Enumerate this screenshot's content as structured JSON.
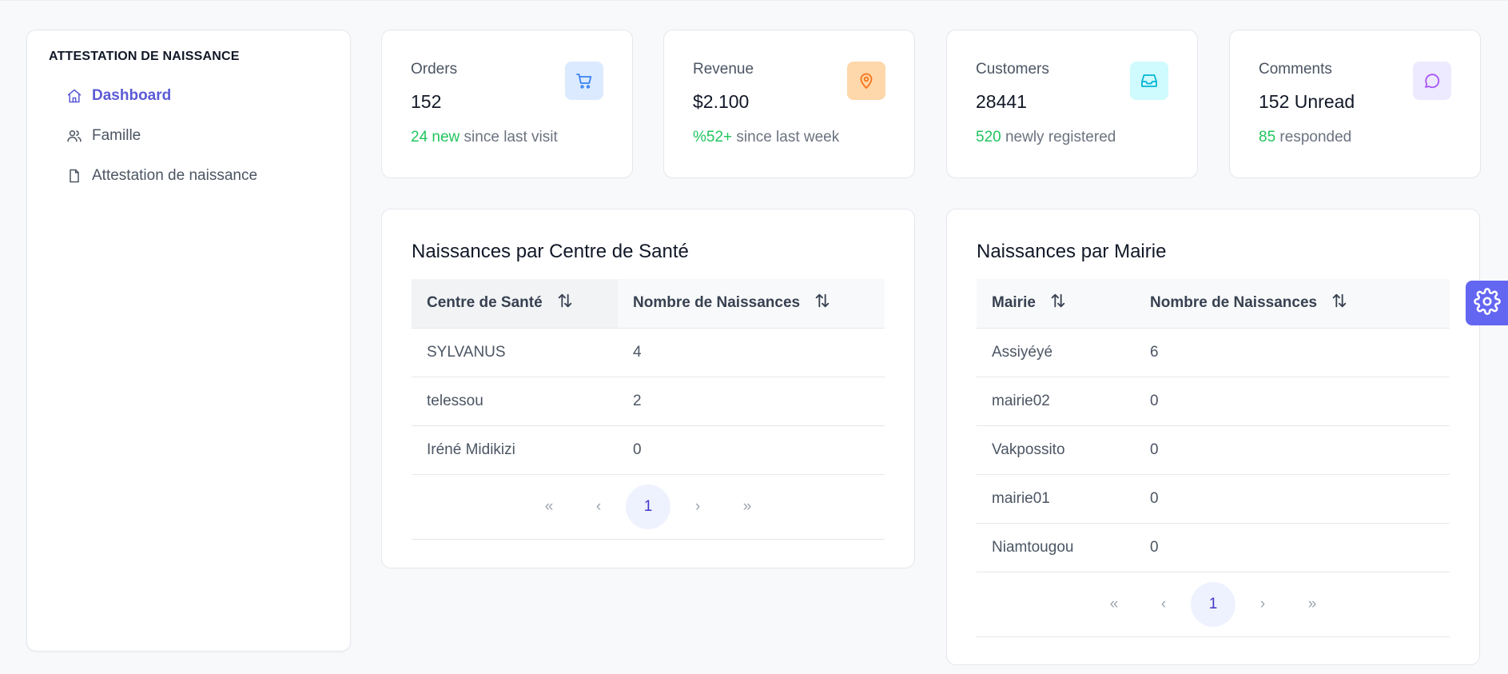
{
  "sidebar": {
    "brand": "ATTESTATION DE NAISSANCE",
    "items": [
      {
        "label": "Dashboard",
        "icon": "home-icon",
        "active": true
      },
      {
        "label": "Famille",
        "icon": "users-icon",
        "active": false
      },
      {
        "label": "Attestation de naissance",
        "icon": "file-icon",
        "active": false
      }
    ]
  },
  "stats": [
    {
      "label": "Orders",
      "value": "152",
      "highlight": "24 new",
      "rest": " since last visit",
      "icon": "cart-icon",
      "badge_bg": "#dbeafe",
      "icon_color": "#3b82f6"
    },
    {
      "label": "Revenue",
      "value": "$2.100",
      "highlight": "%52+",
      "rest": " since last week",
      "icon": "map-pin-icon",
      "badge_bg": "#fed7aa",
      "icon_color": "#f97316"
    },
    {
      "label": "Customers",
      "value": "28441",
      "highlight": "520",
      "rest": " newly registered",
      "icon": "inbox-icon",
      "badge_bg": "#cffafe",
      "icon_color": "#06b6d4"
    },
    {
      "label": "Comments",
      "value": "152 Unread",
      "highlight": "85",
      "rest": " responded",
      "icon": "chat-icon",
      "badge_bg": "#ede9fe",
      "icon_color": "#a855f7"
    }
  ],
  "centre_panel": {
    "title": "Naissances par Centre de Santé",
    "headers": [
      "Centre de Santé",
      "Nombre de Naissances"
    ],
    "rows": [
      [
        "SYLVANUS",
        "4"
      ],
      [
        "telessou",
        "2"
      ],
      [
        "Iréné Midikizi",
        "0"
      ]
    ],
    "pager": {
      "first": "«",
      "prev": "‹",
      "current": "1",
      "next": "›",
      "last": "»"
    }
  },
  "mairie_panel": {
    "title": "Naissances par Mairie",
    "headers": [
      "Mairie",
      "Nombre de Naissances"
    ],
    "rows": [
      [
        "Assiyéyé",
        "6"
      ],
      [
        "mairie02",
        "0"
      ],
      [
        "Vakpossito",
        "0"
      ],
      [
        "mairie01",
        "0"
      ],
      [
        "Niamtougou",
        "0"
      ]
    ],
    "pager": {
      "first": "«",
      "prev": "‹",
      "current": "1",
      "next": "›",
      "last": "»"
    }
  },
  "colors": {
    "accent": "#6366f1",
    "success": "#22c55e"
  }
}
